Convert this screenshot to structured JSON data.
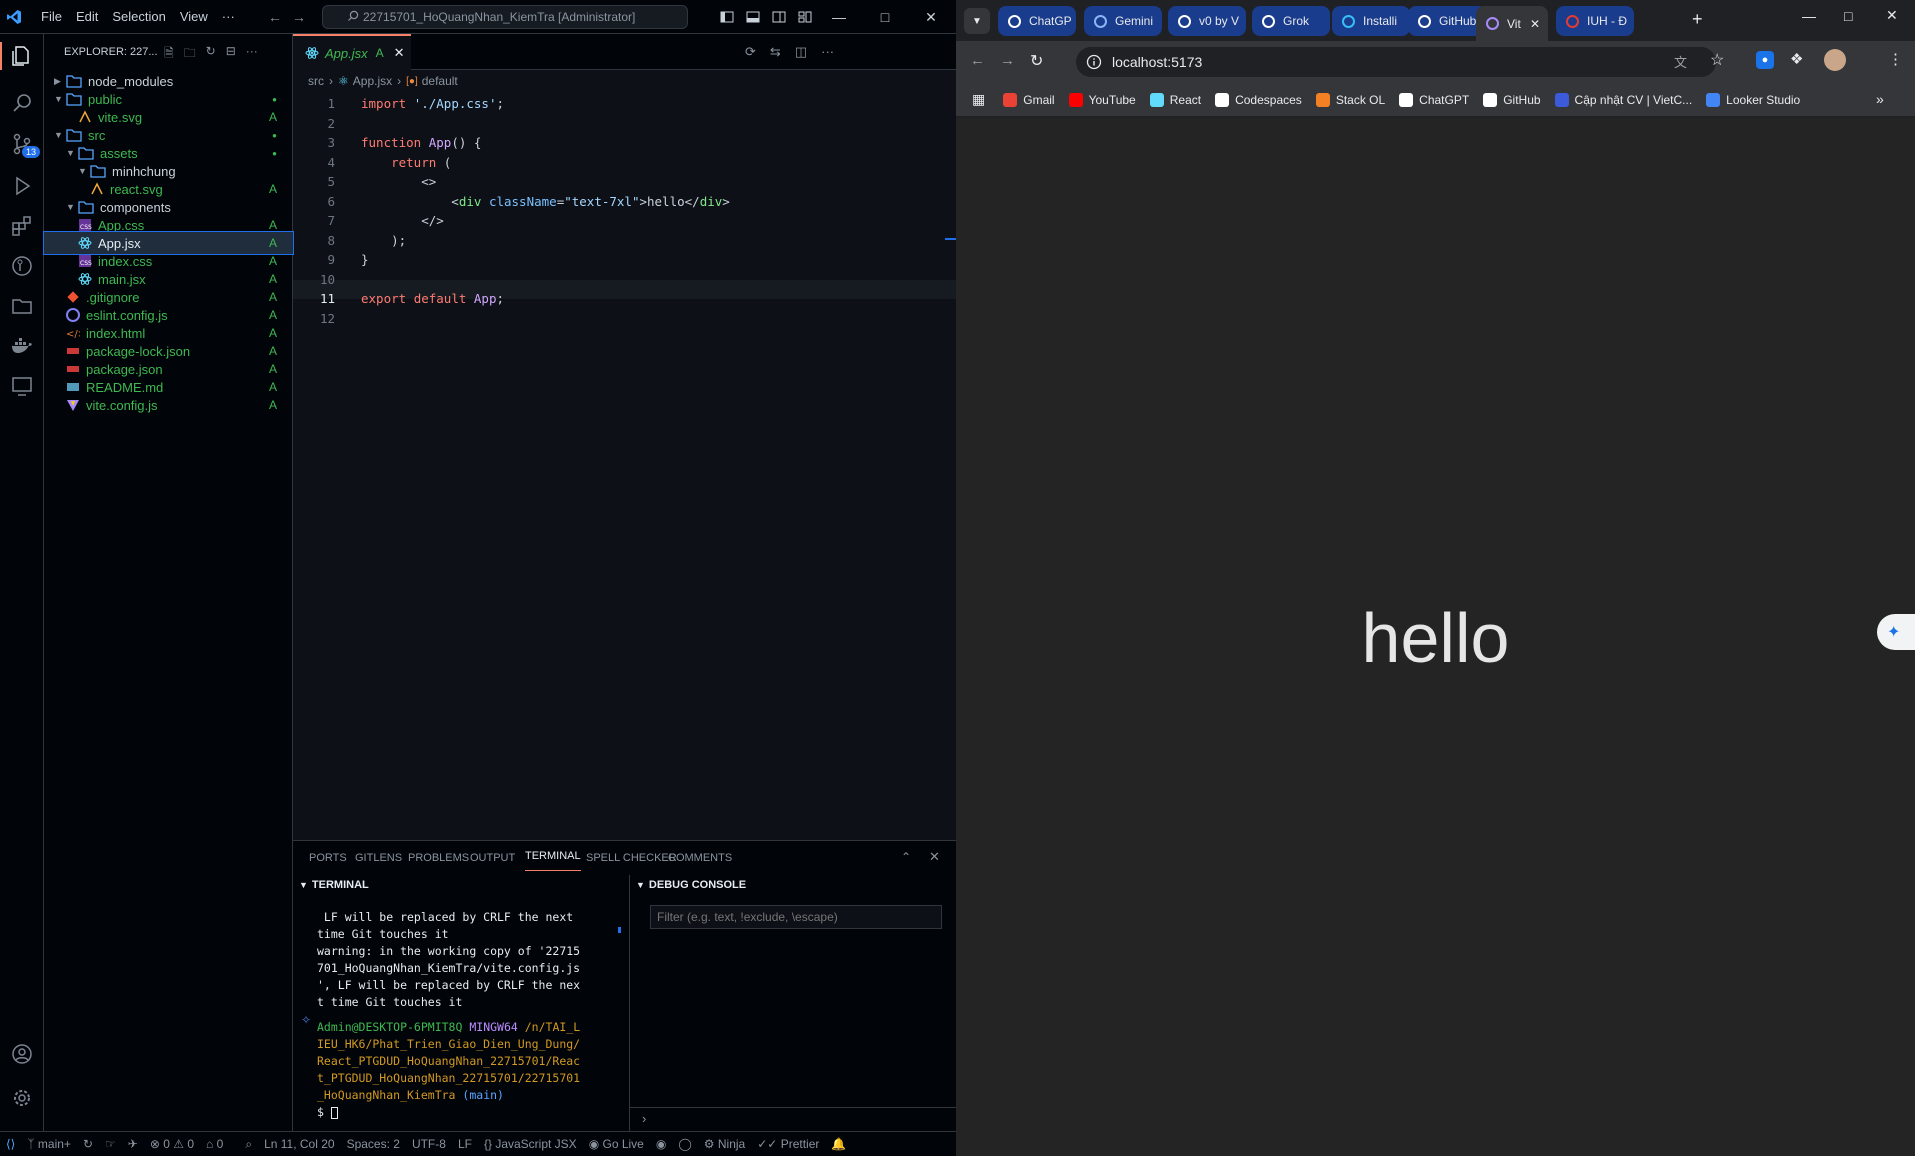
{
  "vscode": {
    "menu": [
      "File",
      "Edit",
      "Selection",
      "View",
      "···"
    ],
    "command_center": "22715701_HoQuangNhan_KiemTra [Administrator]",
    "scm_badge": "13",
    "explorer_title": "EXPLORER: 227...",
    "tree": [
      {
        "label": "node_modules",
        "kind": "folder",
        "depth": 0,
        "expanded": false,
        "status": ""
      },
      {
        "label": "public",
        "kind": "folder",
        "depth": 0,
        "expanded": true,
        "status": "●"
      },
      {
        "label": "vite.svg",
        "kind": "file-svg",
        "depth": 1,
        "status": "A"
      },
      {
        "label": "src",
        "kind": "folder",
        "depth": 0,
        "expanded": true,
        "status": "●"
      },
      {
        "label": "assets",
        "kind": "folder",
        "depth": 1,
        "expanded": true,
        "status": "●"
      },
      {
        "label": "minhchung",
        "kind": "folder",
        "depth": 2,
        "expanded": true,
        "status": ""
      },
      {
        "label": "react.svg",
        "kind": "file-svg",
        "depth": 2,
        "status": "A"
      },
      {
        "label": "components",
        "kind": "folder",
        "depth": 1,
        "expanded": true,
        "status": ""
      },
      {
        "label": "App.css",
        "kind": "file-css",
        "depth": 1,
        "status": "A"
      },
      {
        "label": "App.jsx",
        "kind": "file-react",
        "depth": 1,
        "status": "A",
        "selected": true
      },
      {
        "label": "index.css",
        "kind": "file-css",
        "depth": 1,
        "status": "A"
      },
      {
        "label": "main.jsx",
        "kind": "file-react",
        "depth": 1,
        "status": "A"
      },
      {
        "label": ".gitignore",
        "kind": "file-git",
        "depth": 0,
        "status": "A"
      },
      {
        "label": "eslint.config.js",
        "kind": "file-eslint",
        "depth": 0,
        "status": "A"
      },
      {
        "label": "index.html",
        "kind": "file-html",
        "depth": 0,
        "status": "A"
      },
      {
        "label": "package-lock.json",
        "kind": "file-npm",
        "depth": 0,
        "status": "A"
      },
      {
        "label": "package.json",
        "kind": "file-npm",
        "depth": 0,
        "status": "A"
      },
      {
        "label": "README.md",
        "kind": "file-md",
        "depth": 0,
        "status": "A"
      },
      {
        "label": "vite.config.js",
        "kind": "file-vite",
        "depth": 0,
        "status": "A"
      }
    ],
    "editor_tab": {
      "label": "App.jsx",
      "status": "A"
    },
    "breadcrumb": [
      "src",
      "App.jsx",
      "default"
    ],
    "code_lines": [
      [
        {
          "t": "import ",
          "c": "#ff7b72"
        },
        {
          "t": "'./App.css'",
          "c": "#a5d6ff"
        },
        {
          "t": ";",
          "c": "#c9d1d9"
        }
      ],
      [],
      [
        {
          "t": "function ",
          "c": "#ff7b72"
        },
        {
          "t": "App",
          "c": "#d2a8ff"
        },
        {
          "t": "() {",
          "c": "#c9d1d9"
        }
      ],
      [
        {
          "t": "    return ",
          "c": "#ff7b72"
        },
        {
          "t": "(",
          "c": "#c9d1d9"
        }
      ],
      [
        {
          "t": "        <>",
          "c": "#c9d1d9"
        }
      ],
      [
        {
          "t": "            <",
          "c": "#c9d1d9"
        },
        {
          "t": "div ",
          "c": "#7ee787"
        },
        {
          "t": "className",
          "c": "#79c0ff"
        },
        {
          "t": "=",
          "c": "#c9d1d9"
        },
        {
          "t": "\"text-7xl\"",
          "c": "#a5d6ff"
        },
        {
          "t": ">hello</",
          "c": "#c9d1d9"
        },
        {
          "t": "div",
          "c": "#7ee787"
        },
        {
          "t": ">",
          "c": "#c9d1d9"
        }
      ],
      [
        {
          "t": "        </>",
          "c": "#c9d1d9"
        }
      ],
      [
        {
          "t": "    );",
          "c": "#c9d1d9"
        }
      ],
      [
        {
          "t": "}",
          "c": "#c9d1d9"
        }
      ],
      [],
      [
        {
          "t": "export ",
          "c": "#ff7b72"
        },
        {
          "t": "default ",
          "c": "#ff7b72"
        },
        {
          "t": "App",
          "c": "#d2a8ff"
        },
        {
          "t": ";",
          "c": "#c9d1d9"
        }
      ],
      []
    ],
    "current_line": 11,
    "panel_tabs": [
      "PORTS",
      "GITLENS",
      "PROBLEMS",
      "OUTPUT",
      "TERMINAL",
      "SPELL CHECKER",
      "COMMENTS"
    ],
    "active_panel_tab": "TERMINAL",
    "terminal_title": "TERMINAL",
    "debug_title": "DEBUG CONSOLE",
    "debug_filter_placeholder": "Filter (e.g. text, !exclude, \\escape)",
    "terminal_lines": [
      {
        "t": " LF will be replaced by CRLF the next",
        "c": "#e6edf3"
      },
      {
        "t": "time Git touches it",
        "c": "#e6edf3"
      },
      {
        "t": "warning: in the working copy of '22715",
        "c": "#e6edf3"
      },
      {
        "t": "701_HoQuangNhan_KiemTra/vite.config.js",
        "c": "#e6edf3"
      },
      {
        "t": "', LF will be replaced by CRLF the nex",
        "c": "#e6edf3"
      },
      {
        "t": "t time Git touches it",
        "c": "#e6edf3"
      }
    ],
    "prompt_user": "Admin@DESKTOP-6PMIT8Q",
    "prompt_shell": "MINGW64",
    "prompt_path_lines": [
      "/n/TAI_L",
      "IEU_HK6/Phat_Trien_Giao_Dien_Ung_Dung/",
      "React_PTGDUD_HoQuangNhan_22715701/Reac",
      "t_PTGDUD_HoQuangNhan_22715701/22715701",
      "_HoQuangNhan_KiemTra"
    ],
    "prompt_branch": "(main)",
    "prompt_symbol": "$",
    "status": {
      "branch": "main+",
      "errors": "0",
      "warnings": "0",
      "ports": "0",
      "position": "Ln 11, Col 20",
      "spaces": "Spaces: 2",
      "encoding": "UTF-8",
      "eol": "LF",
      "language": "JavaScript JSX",
      "golive": "Go Live",
      "ninja": "Ninja",
      "prettier": "Prettier"
    }
  },
  "browser": {
    "tabs": [
      {
        "label": "ChatGP",
        "icon": "chatgpt-icon"
      },
      {
        "label": "Gemini",
        "icon": "gemini-icon"
      },
      {
        "label": "v0 by V",
        "icon": "v0-icon"
      },
      {
        "label": "Grok",
        "icon": "grok-icon"
      },
      {
        "label": "Installi",
        "icon": "tailwind-icon"
      },
      {
        "label": "GitHub",
        "icon": "github-icon"
      },
      {
        "label": "Vit",
        "icon": "vite-icon",
        "active": true
      },
      {
        "label": "IUH - Đ",
        "icon": "iuh-icon"
      }
    ],
    "url": "localhost:5173",
    "bookmarks": [
      {
        "label": "Gmail",
        "color": "#ea4335"
      },
      {
        "label": "YouTube",
        "color": "#ff0000"
      },
      {
        "label": "React",
        "color": "#61dafb"
      },
      {
        "label": "Codespaces",
        "color": "#ffffff"
      },
      {
        "label": "Stack OL",
        "color": "#f48024"
      },
      {
        "label": "ChatGPT",
        "color": "#ffffff"
      },
      {
        "label": "GitHub",
        "color": "#ffffff"
      },
      {
        "label": "Cập nhật CV | VietC...",
        "color": "#3b5bdb"
      },
      {
        "label": "Looker Studio",
        "color": "#4285f4"
      }
    ],
    "page_text": "hello"
  }
}
